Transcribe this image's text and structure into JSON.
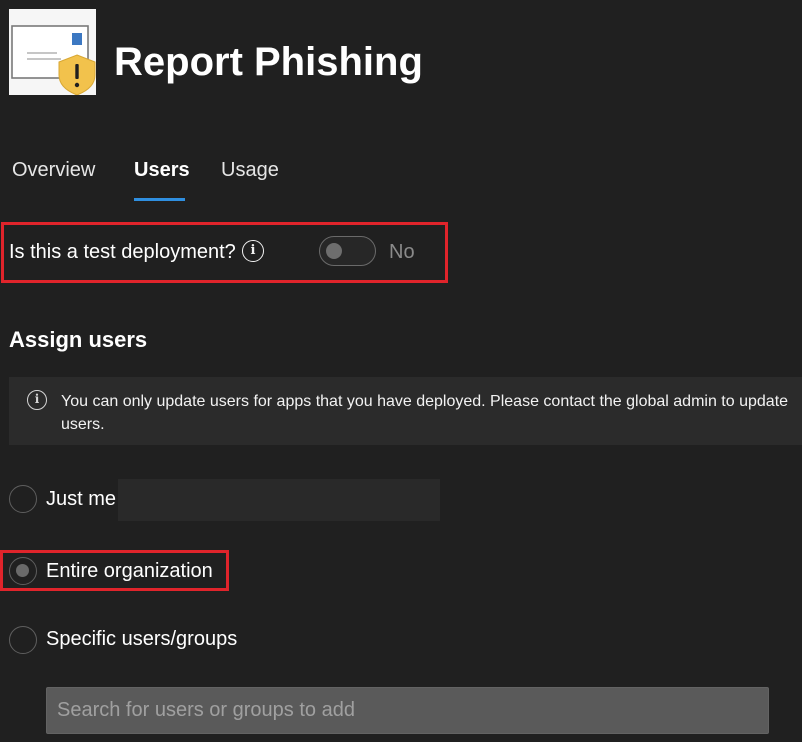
{
  "app": {
    "title": "Report Phishing",
    "icon_name": "report-phishing-envelope-shield-icon"
  },
  "tabs": [
    {
      "label": "Overview",
      "selected": false
    },
    {
      "label": "Users",
      "selected": true
    },
    {
      "label": "Usage",
      "selected": false
    }
  ],
  "test_deployment": {
    "question": "Is this a test deployment?",
    "info_icon_glyph": "i",
    "toggle_on": false,
    "state_label": "No"
  },
  "assign_users": {
    "heading": "Assign users",
    "info_icon_glyph": "i",
    "info_message": "You can only update users for apps that you have deployed. Please contact the global admin to update users.",
    "options": [
      {
        "label": "Just me",
        "selected": false
      },
      {
        "label": "Entire organization",
        "selected": true
      },
      {
        "label": "Specific users/groups",
        "selected": false
      }
    ],
    "search_placeholder": "Search for users or groups to add"
  },
  "colors": {
    "background": "#202020",
    "accent": "#2f8fe0",
    "highlight": "#e0242b",
    "info_bar": "#2b2b2b",
    "search_field": "#5a5a5a"
  }
}
